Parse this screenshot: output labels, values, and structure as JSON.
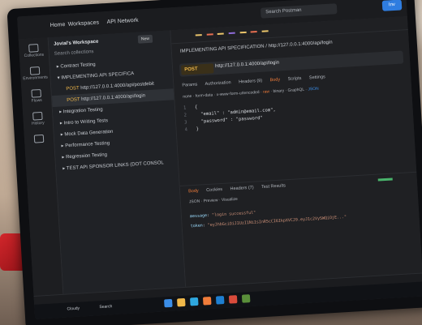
{
  "scene": {
    "description_colors": {
      "desk": "#bfa994",
      "red_object": "#d2262b",
      "screen_bg": "#202226"
    }
  },
  "app": {
    "top_nav": {
      "home": "Home",
      "workspaces": "Workspaces",
      "api_network": "API Network"
    },
    "search_placeholder": "Search Postman",
    "invite_label": "Inv"
  },
  "rail": {
    "items": [
      {
        "label": "Collections",
        "icon": "collections-icon"
      },
      {
        "label": "Environments",
        "icon": "environments-icon"
      },
      {
        "label": "Flows",
        "icon": "flows-icon"
      },
      {
        "label": "History",
        "icon": "history-icon"
      },
      {
        "label": "",
        "icon": "grid-icon"
      }
    ]
  },
  "sidebar": {
    "workspace_title": "Jovial's Workspace",
    "new_label": "New",
    "search_placeholder": "Search collections",
    "items": [
      {
        "label": "Contract Testing",
        "level": 0
      },
      {
        "label": "IMPLEMENTING API SPECIFICA",
        "level": 0
      },
      {
        "label": "http://127.0.0.1:4000/api/postdebit",
        "level": 1
      },
      {
        "label": "http://127.0.0.1:4000/api/login",
        "level": 1,
        "selected": true
      },
      {
        "label": "Integration Testing",
        "level": 0
      },
      {
        "label": "Intro to Writing Tests",
        "level": 0
      },
      {
        "label": "Mock Data Generation",
        "level": 0
      },
      {
        "label": "Performance Testing",
        "level": 0
      },
      {
        "label": "Regression Testing",
        "level": 0
      },
      {
        "label": "TEST API SPONSOR LINKS (DOT CONSOL",
        "level": 0
      }
    ]
  },
  "request": {
    "breadcrumb": "IMPLEMENTING API SPECIFICATION / http://127.0.0.1:4000/api/login",
    "method": "POST",
    "url": "http://127.0.0.1:4000/api/login",
    "tabs": [
      "Params",
      "Authorization",
      "Headers (9)",
      "Body",
      "Scripts",
      "Settings"
    ],
    "active_tab": "Body",
    "body_options": [
      "none",
      "form-data",
      "x-www-form-urlencoded",
      "raw",
      "binary",
      "GraphQL",
      "JSON"
    ],
    "body_lines": [
      "{",
      "  \"email\" : \"admin@email.com\",",
      "  \"password\" : \"password\"",
      "}"
    ]
  },
  "response": {
    "tabs": [
      "Body",
      "Cookies",
      "Headers (7)",
      "Test Results"
    ],
    "active_tab": "Body",
    "options": [
      "JSON",
      "Preview",
      "Visualize"
    ],
    "lines": [
      {
        "key": "message",
        "value": "\"login successful\""
      },
      {
        "key": "token",
        "value": "\"eyJhbGciOiJIUzI1NiIsInR5cCI6IkpXVCJ9.eyJ1c2VySWQiOjE...\""
      }
    ]
  },
  "taskbar": {
    "weather": "Cloudy",
    "search_label": "Search"
  }
}
